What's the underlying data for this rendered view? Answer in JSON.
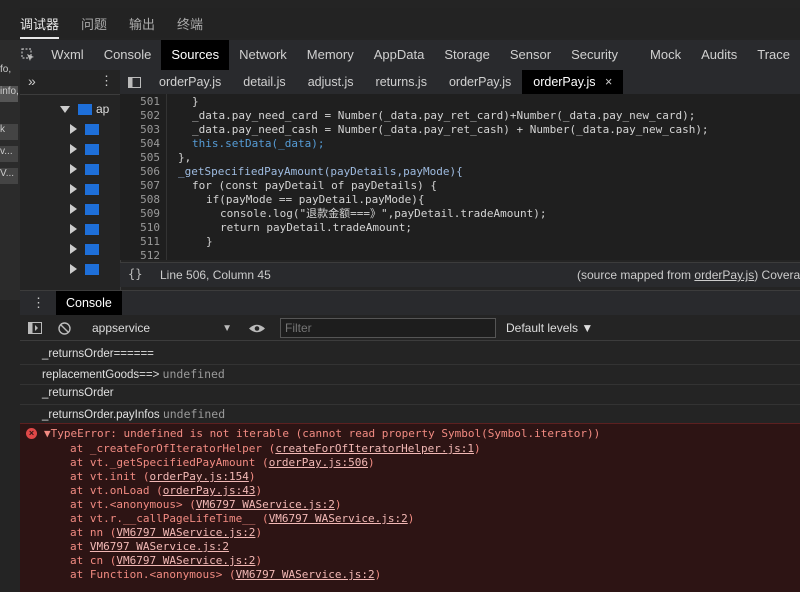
{
  "top_tabs": [
    "调试器",
    "问题",
    "输出",
    "终端"
  ],
  "left_strip": [
    "fo,",
    "info,",
    "k",
    "v...",
    "V..."
  ],
  "devtools_tabs": [
    "Wxml",
    "Console",
    "Sources",
    "Network",
    "Memory",
    "AppData",
    "Storage",
    "Sensor",
    "Security",
    "Mock",
    "Audits",
    "Trace"
  ],
  "devtools_active": "Sources",
  "file_tabs": [
    "orderPay.js",
    "detail.js",
    "adjust.js",
    "returns.js",
    "orderPay.js",
    "orderPay.js"
  ],
  "file_tab_close": "×",
  "nav": {
    "more": "»",
    "menu": "⋮",
    "folder_label": "ap"
  },
  "code_lines": [
    {
      "n": "501",
      "t": "}"
    },
    {
      "n": "502",
      "t": "_data.pay_need_card = Number(_data.pay_ret_card)+Number(_data.pay_new_card);"
    },
    {
      "n": "503",
      "t": "_data.pay_need_cash = Number(_data.pay_ret_cash) + Number(_data.pay_new_cash);"
    },
    {
      "n": "504",
      "t": "this.setData(_data);"
    },
    {
      "n": "505",
      "t": "},"
    },
    {
      "n": "506",
      "t": "_getSpecifiedPayAmount(payDetails,payMode){"
    },
    {
      "n": "507",
      "t": "for (const payDetail of payDetails) {"
    },
    {
      "n": "508",
      "t": "if(payMode == payDetail.payMode){"
    },
    {
      "n": "509",
      "t": "console.log(\"退款金额===》\",payDetail.tradeAmount);"
    },
    {
      "n": "510",
      "t": "return payDetail.tradeAmount;"
    },
    {
      "n": "511",
      "t": "}"
    },
    {
      "n": "512",
      "t": ""
    }
  ],
  "status": {
    "braces": "{}",
    "position": "Line 506, Column 45",
    "source_prefix": "(source mapped from ",
    "source_link": "orderPay.js",
    "source_suffix": ") Coverag"
  },
  "drawer": {
    "menu": "⋮",
    "tab": "Console"
  },
  "console_toolbar": {
    "context": "appservice",
    "filter_placeholder": "Filter",
    "levels": "Default levels ▼"
  },
  "console_logs": [
    {
      "text": "_returnsOrder======",
      "extra": ""
    },
    {
      "text": "replacementGoods==>",
      "extra": "undefined"
    },
    {
      "text": "_returnsOrder",
      "extra": ""
    },
    {
      "text": "_returnsOrder.payInfos",
      "extra": "undefined"
    }
  ],
  "error": {
    "message": "▼TypeError: undefined is not iterable (cannot read property Symbol(Symbol.iterator))",
    "stack": [
      {
        "at": "at _createForOfIteratorHelper (",
        "link": "createForOfIteratorHelper.js:1",
        "end": ")"
      },
      {
        "at": "at vt._getSpecifiedPayAmount (",
        "link": "orderPay.js:506",
        "end": ")"
      },
      {
        "at": "at vt.init (",
        "link": "orderPay.js:154",
        "end": ")"
      },
      {
        "at": "at vt.onLoad (",
        "link": "orderPay.js:43",
        "end": ")"
      },
      {
        "at": "at vt.<anonymous> (",
        "link": "VM6797 WAService.js:2",
        "end": ")"
      },
      {
        "at": "at vt.r.__callPageLifeTime__ (",
        "link": "VM6797 WAService.js:2",
        "end": ")"
      },
      {
        "at": "at nn (",
        "link": "VM6797 WAService.js:2",
        "end": ")"
      },
      {
        "at": "at ",
        "link": "VM6797 WAService.js:2",
        "end": ""
      },
      {
        "at": "at cn (",
        "link": "VM6797 WAService.js:2",
        "end": ")"
      },
      {
        "at": "at Function.<anonymous> (",
        "link": "VM6797 WAService.js:2",
        "end": ")"
      }
    ]
  }
}
